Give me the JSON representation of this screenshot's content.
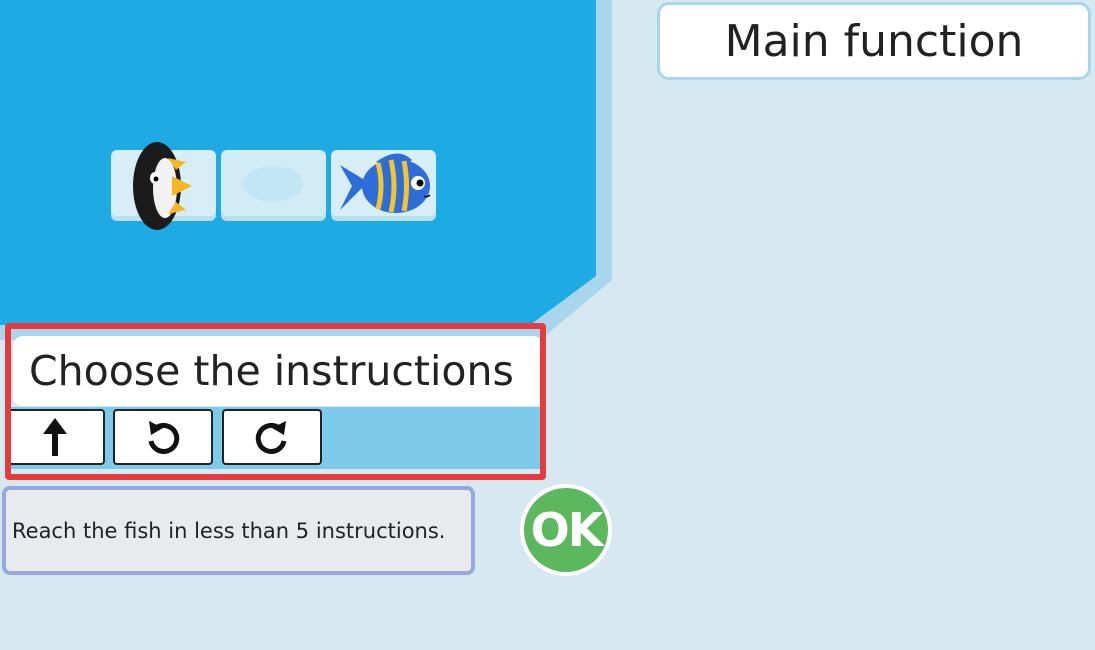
{
  "main_function": {
    "title": "Main function"
  },
  "instructions": {
    "title": "Choose the instructions",
    "buttons": [
      {
        "name": "move-forward",
        "icon": "arrow-up-icon"
      },
      {
        "name": "turn-left",
        "icon": "rotate-left-icon"
      },
      {
        "name": "turn-right",
        "icon": "rotate-right-icon"
      }
    ]
  },
  "hint": {
    "text": "Reach the fish in less than 5 instructions."
  },
  "ok_button": {
    "label": "OK"
  },
  "colors": {
    "water": "#1eabe3",
    "background": "#d6e8f0",
    "highlight": "#e63a3e",
    "ok": "#5cb85c"
  }
}
